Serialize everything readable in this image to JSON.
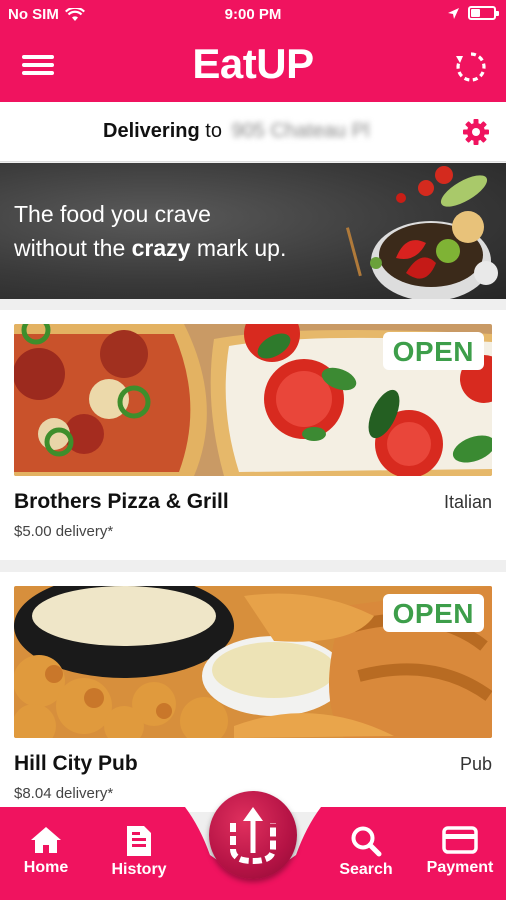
{
  "status_bar": {
    "carrier": "No SIM",
    "time": "9:00 PM"
  },
  "app_bar": {
    "title": "EatUP",
    "menu_icon": "menu-icon",
    "refresh_icon": "refresh-icon"
  },
  "delivering": {
    "label": "Delivering",
    "to": "to",
    "address": "905 Chateau Pl",
    "settings_icon": "gear-icon"
  },
  "banner": {
    "line1": "The food you crave",
    "line2_start": "without the ",
    "line2_bold": "crazy",
    "line2_end": " mark up."
  },
  "restaurants": [
    {
      "name": "Brothers Pizza & Grill",
      "cuisine": "Italian",
      "delivery": "$5.00 delivery*",
      "status": "OPEN"
    },
    {
      "name": "Hill City Pub",
      "cuisine": "Pub",
      "delivery": "$8.04 delivery*",
      "status": "OPEN"
    }
  ],
  "tabs": [
    {
      "label": "Home",
      "icon": "home-icon"
    },
    {
      "label": "History",
      "icon": "document-icon"
    },
    {
      "label": "Search",
      "icon": "search-icon"
    },
    {
      "label": "Payment",
      "icon": "credit-card-icon"
    }
  ],
  "colors": {
    "brand": "#f0135f",
    "open_green": "#3d9e4a"
  }
}
